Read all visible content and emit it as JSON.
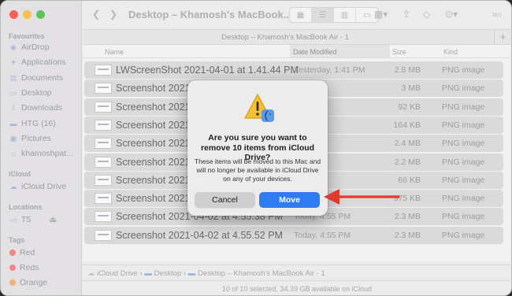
{
  "sidebar": {
    "favourites_header": "Favourites",
    "favourites": [
      {
        "label": "AirDrop",
        "icon": "airdrop-icon"
      },
      {
        "label": "Applications",
        "icon": "applications-icon"
      },
      {
        "label": "Documents",
        "icon": "document-icon"
      },
      {
        "label": "Desktop",
        "icon": "desktop-icon"
      },
      {
        "label": "Downloads",
        "icon": "downloads-icon"
      },
      {
        "label": "HTG (16)",
        "icon": "folder-icon"
      },
      {
        "label": "Pictures",
        "icon": "pictures-icon"
      },
      {
        "label": "khamoshpat...",
        "icon": "home-icon"
      }
    ],
    "icloud_header": "iCloud",
    "icloud": [
      {
        "label": "iCloud Drive",
        "icon": "cloud-icon"
      }
    ],
    "locations_header": "Locations",
    "locations": [
      {
        "label": "T5",
        "icon": "drive-icon"
      }
    ],
    "tags_header": "Tags",
    "tags": [
      {
        "label": "Red",
        "color": "#f0868a"
      },
      {
        "label": "Reds",
        "color": "#f0868a"
      },
      {
        "label": "Orange",
        "color": "#f5b370"
      }
    ]
  },
  "toolbar": {
    "title": "Desktop – Khamosh's MacBook..."
  },
  "path_tab": "Desktop – Khamosh's MacBook Air - 1",
  "columns": {
    "name": "Name",
    "date": "Date Modified",
    "size": "Size",
    "kind": "Kind"
  },
  "files": [
    {
      "name": "LWScreenShot 2021-04-01 at 1.41.44 PM",
      "date": "Yesterday, 1:41 PM",
      "size": "2.8 MB",
      "kind": "PNG image"
    },
    {
      "name": "Screenshot 2021-0",
      "date": "",
      "size": "3 MB",
      "kind": "PNG image"
    },
    {
      "name": "Screenshot 2021-0",
      "date": "",
      "size": "92 KB",
      "kind": "PNG image"
    },
    {
      "name": "Screenshot 2021-0",
      "date": "",
      "size": "164 KB",
      "kind": "PNG image"
    },
    {
      "name": "Screenshot 2021-0",
      "date": "55 PM",
      "size": "2.4 MB",
      "kind": "PNG image"
    },
    {
      "name": "Screenshot 2021-0",
      "date": "55 PM",
      "size": "2.2 MB",
      "kind": "PNG image"
    },
    {
      "name": "Screenshot 2021-0",
      "date": "55 PM",
      "size": "66 KB",
      "kind": "PNG image"
    },
    {
      "name": "Screenshot 2021-0",
      "date": "55 PM",
      "size": "375 KB",
      "kind": "PNG image"
    },
    {
      "name": "Screenshot 2021-04-02 at 4.55.38 PM",
      "date": "Today, 4:55 PM",
      "size": "2.3 MB",
      "kind": "PNG image"
    },
    {
      "name": "Screenshot 2021-04-02 at 4.55.52 PM",
      "date": "Today, 4:55 PM",
      "size": "2.3 MB",
      "kind": "PNG image"
    }
  ],
  "pathbar": [
    "iCloud Drive",
    "Desktop",
    "Desktop – Khamosh's MacBook Air - 1"
  ],
  "status": "10 of 10 selected, 34.39 GB available on iCloud",
  "dialog": {
    "title": "Are you sure you want to remove 10 items from iCloud Drive?",
    "message": "These items will be moved to this Mac and will no longer be available in iCloud Drive on any of your devices.",
    "cancel_label": "Cancel",
    "move_label": "Move",
    "accent": "#2f7cf2"
  },
  "annotation": {
    "arrow_color": "#e03a2e"
  }
}
